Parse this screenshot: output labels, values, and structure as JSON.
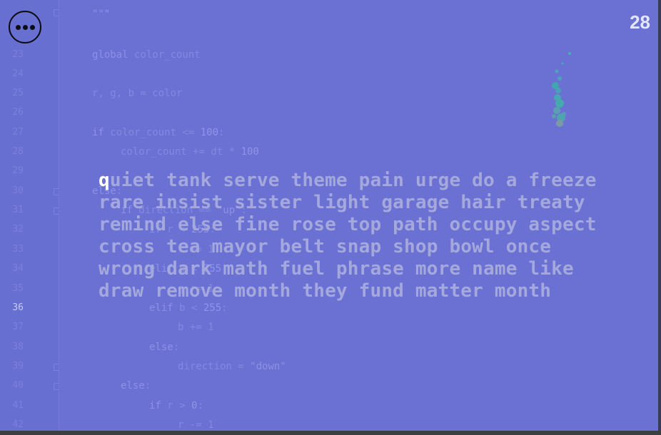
{
  "timer": "28",
  "menu_icon": "more-horizontal-icon",
  "gutter": {
    "current_line": "36",
    "line_numbers": [
      "23",
      "24",
      "25",
      "26",
      "27",
      "28",
      "29",
      "30",
      "31",
      "32",
      "33",
      "34",
      "35",
      "36",
      "37",
      "38",
      "39",
      "40",
      "41",
      "42"
    ]
  },
  "code": {
    "top_string": "\"\"\"",
    "line_23": [
      "global",
      " color_count"
    ],
    "line_25": "r, g, b = color",
    "line_27": [
      "if",
      " color_count <= ",
      "100",
      ":"
    ],
    "line_28": [
      "color_count += dt * ",
      "100"
    ],
    "line_30": [
      "else",
      ":"
    ],
    "line_31": [
      "if",
      " direction == ",
      "\"up\"",
      ":"
    ],
    "line_32": [
      "if",
      " r < ",
      "255",
      ":"
    ],
    "line_33": "r += 1",
    "line_34": [
      "elif",
      " g < ",
      "255",
      ":"
    ],
    "line_35": "g += 1",
    "line_36": [
      "elif",
      " b < ",
      "255",
      ":"
    ],
    "line_37": "b += 1",
    "line_38": [
      "else",
      ":"
    ],
    "line_39": [
      "direction = ",
      "\"down\""
    ],
    "line_40": [
      "else",
      ":"
    ],
    "line_41": [
      "if",
      " r > ",
      "0",
      ":"
    ],
    "line_42": "r -= 1"
  },
  "typing_text": {
    "first_char": "q",
    "lines": [
      "uiet tank serve theme pain urge do a freeze",
      "rare insist sister light garage hair treaty",
      "remind else fine rose top path occupy aspect",
      "cross tea mayor belt snap shop bowl once",
      "wrong dark math fuel phrase more name like",
      "draw remove month they fund matter month"
    ]
  },
  "colors": {
    "background": "#6a71d3",
    "current_char": "#ffffff",
    "pending_text": "#a4a8dc"
  }
}
